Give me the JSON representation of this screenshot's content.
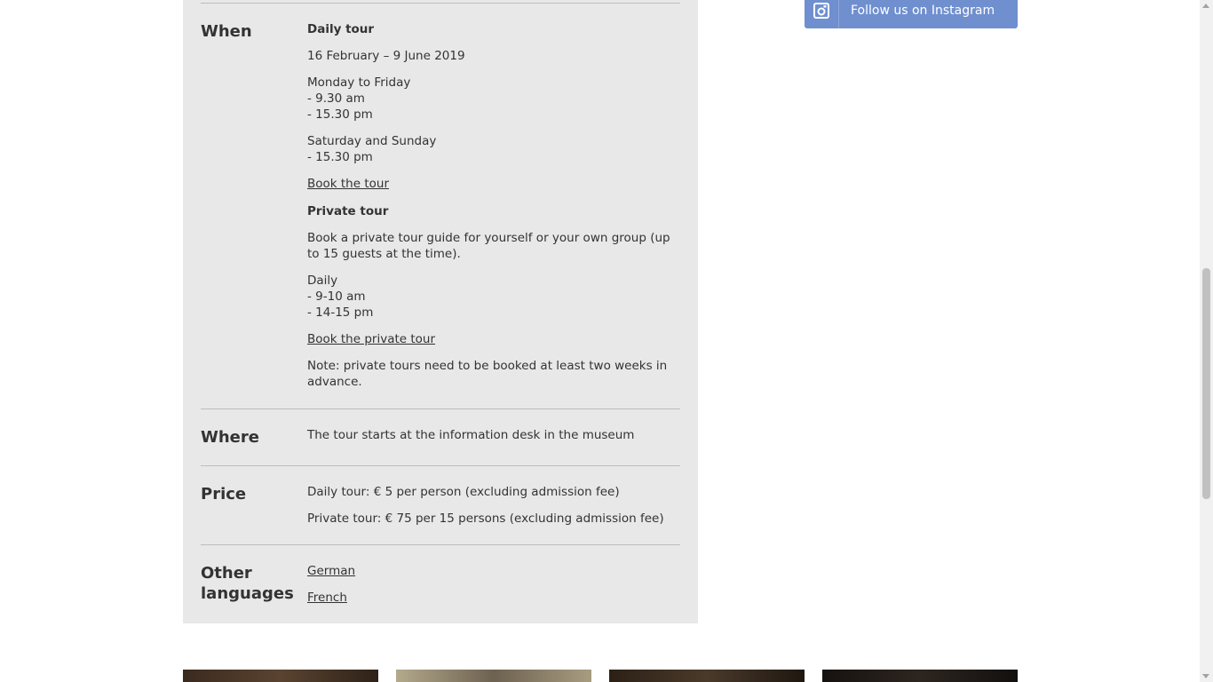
{
  "instagram": {
    "label": "Follow us on Instagram",
    "icon": "instagram-icon",
    "color": "#6f8fcf"
  },
  "when": {
    "label": "When",
    "daily_heading": "Daily tour",
    "dates": "16 February – 9 June 2019",
    "weekdays": [
      "Monday to Friday",
      "- 9.30 am",
      "- 15.30 pm"
    ],
    "weekend": [
      "Saturday and Sunday",
      "- 15.30 pm"
    ],
    "book_tour": "Book the tour",
    "private_heading": "Private tour",
    "private_desc": "Book a private tour guide for yourself or your own group (up to 15 guests at the time).",
    "private_times": [
      "Daily",
      "- 9-10 am",
      "- 14-15 pm"
    ],
    "book_private": "Book the private tour",
    "note": "Note: private tours need to be booked at least two weeks in advance."
  },
  "where": {
    "label": "Where",
    "text": "The tour starts at the information desk in the museum"
  },
  "price": {
    "label": "Price",
    "daily": "Daily tour: € 5 per person (excluding admission fee)",
    "private": "Private tour: € 75 per 15 persons (excluding admission fee)"
  },
  "languages": {
    "label_line1": "Other",
    "label_line2": "languages",
    "links": [
      "German",
      "French"
    ]
  },
  "colors": {
    "panel_bg": "#e8e8e8",
    "text": "#333333",
    "divider": "#bdbdbd"
  }
}
